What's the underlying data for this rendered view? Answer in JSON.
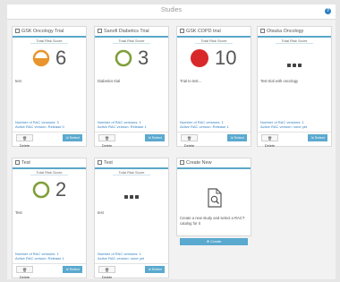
{
  "header": {
    "title": "Studies",
    "help": "?"
  },
  "colors": {
    "accent": "#5aa7c9",
    "orange": "#e8952e",
    "green": "#7f9f3a",
    "red": "#d8282a"
  },
  "common": {
    "total_risk_score": "Total Risk Score",
    "rac1": "Number of RAC versions: 1",
    "delete": "Delete",
    "select": "Select"
  },
  "cards": [
    {
      "title": "GSK Oncology Trial",
      "score": "6",
      "indicator": "half-orange",
      "description": "test",
      "rac1": "Number of RAC versions: 3",
      "rac2": "Active RAC version: Release 0"
    },
    {
      "title": "Sanofi Diabetics Trial",
      "score": "3",
      "indicator": "green-ring",
      "description": "Diabetics trial",
      "rac1": "Number of RAC versions: 1",
      "rac2": "Active RAC version: Release 1"
    },
    {
      "title": "GSK COPD trial",
      "score": "10",
      "indicator": "red-dot",
      "description": "Trial to test...",
      "rac1": "Number of RAC versions: 1",
      "rac2": "Active RAC version: Release 1"
    },
    {
      "title": "Otsuka Oncology",
      "score": "",
      "indicator": "dots",
      "description": "Test trial with oncology",
      "rac1": "Number of RAC versions: 1",
      "rac2": "Active RAC version: none yet"
    },
    {
      "title": "Test",
      "score": "2",
      "indicator": "green-ring",
      "description": "Test",
      "rac1": "Number of RAC versions: 1",
      "rac2": "Active RAC version: Release 1"
    },
    {
      "title": "Test",
      "score": "",
      "indicator": "dots",
      "description": "test",
      "rac1": "Number of RAC versions: 1",
      "rac2": "Active RAC version: none yet"
    }
  ],
  "create": {
    "title": "Create New",
    "description": "Create a new study and select a RACT catalog for it",
    "button": "Create"
  }
}
